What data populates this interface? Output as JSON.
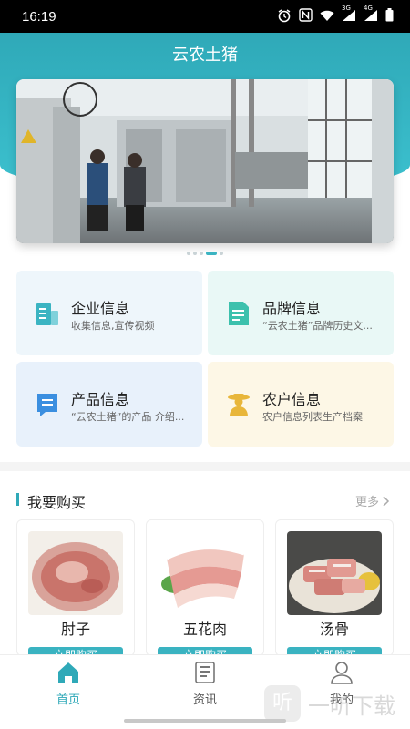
{
  "status_bar": {
    "time": "16:19",
    "icons": [
      "alarm-icon",
      "nfc-icon",
      "wifi-icon",
      "signal-3g-icon",
      "signal-4g-icon",
      "battery-icon"
    ],
    "net1": "3G",
    "net2": "4G"
  },
  "header": {
    "title": "云农土猪"
  },
  "banner": {
    "dot_count": 5,
    "active_index": 3
  },
  "cards": [
    {
      "title": "企业信息",
      "desc": "收集信息,宣传视频",
      "icon": "building-icon",
      "color": "#3bb4c2"
    },
    {
      "title": "品牌信息",
      "desc": "“云农土猪”品牌历史文...",
      "icon": "document-icon",
      "color": "#3cc1ad"
    },
    {
      "title": "产品信息",
      "desc": "“云农土猪”的产品 介绍...",
      "icon": "message-doc-icon",
      "color": "#3b8fe0"
    },
    {
      "title": "农户信息",
      "desc": "农户信息列表生产档案",
      "icon": "farmer-icon",
      "color": "#e8b63a"
    }
  ],
  "buy_section": {
    "title": "我要购买",
    "more": "更多"
  },
  "products": [
    {
      "name": "肘子",
      "button": "立即购买"
    },
    {
      "name": "五花肉",
      "button": "立即购买"
    },
    {
      "name": "汤骨",
      "button": "立即购买"
    }
  ],
  "tabs": [
    {
      "label": "首页",
      "icon": "home-icon",
      "active": true
    },
    {
      "label": "资讯",
      "icon": "news-icon",
      "active": false
    },
    {
      "label": "我的",
      "icon": "user-icon",
      "active": false
    }
  ],
  "watermark": {
    "logo_char": "听",
    "text": "一听下载"
  },
  "colors": {
    "accent": "#2fa9b8",
    "header_top": "#2fa9b8",
    "header_bottom": "#3cc1cf"
  }
}
